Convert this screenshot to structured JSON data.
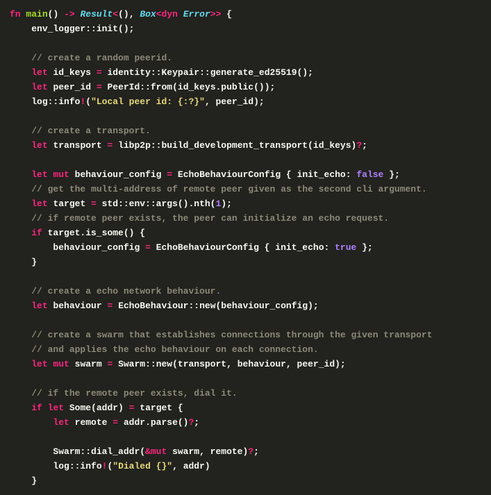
{
  "code": {
    "l1": {
      "kw1": "fn",
      "name": "main",
      "p1": "() ",
      "arrow": "->",
      "sp1": " ",
      "ty1": "Result",
      "lt": "<",
      "p2": "(), ",
      "ty2": "Box",
      "lt2": "<",
      "kw2": "dyn",
      "sp2": " ",
      "ty3": "Error",
      "gt": ">>",
      "sp3": " {"
    },
    "l2": {
      "indent": "    ",
      "t": "env_logger::init();"
    },
    "l4": {
      "indent": "    ",
      "c": "// create a random peerid."
    },
    "l5": {
      "indent": "    ",
      "kw": "let",
      "sp": " ",
      "id": "id_keys ",
      "eq": "=",
      "rest": " identity::Keypair::generate_ed25519();"
    },
    "l6": {
      "indent": "    ",
      "kw": "let",
      "sp": " ",
      "id": "peer_id ",
      "eq": "=",
      "rest": " PeerId::from(id_keys.public());"
    },
    "l7": {
      "indent": "    ",
      "pre": "log::info",
      "bang": "!",
      "p1": "(",
      "str": "\"Local peer id: {:?}\"",
      "rest": ", peer_id);"
    },
    "l9": {
      "indent": "    ",
      "c": "// create a transport."
    },
    "l10": {
      "indent": "    ",
      "kw": "let",
      "sp": " ",
      "id": "transport ",
      "eq": "=",
      "rest": " libp2p::build_development_transport(id_keys)",
      "q": "?",
      "semi": ";"
    },
    "l12": {
      "indent": "    ",
      "kw": "let",
      "sp": " ",
      "kw2": "mut",
      "sp2": " ",
      "id": "behaviour_config ",
      "eq": "=",
      "rest": " EchoBehaviourConfig { init_echo: ",
      "bool": "false",
      "end": " };"
    },
    "l13": {
      "indent": "    ",
      "c": "// get the multi-address of remote peer given as the second cli argument."
    },
    "l14": {
      "indent": "    ",
      "kw": "let",
      "sp": " ",
      "id": "target ",
      "eq": "=",
      "rest": " std::env::args().nth(",
      "num": "1",
      "end": ");"
    },
    "l15": {
      "indent": "    ",
      "c": "// if remote peer exists, the peer can initialize an echo request."
    },
    "l16": {
      "indent": "    ",
      "kw": "if",
      "rest": " target.is_some() {"
    },
    "l17": {
      "indent": "        ",
      "id": "behaviour_config ",
      "eq": "=",
      "rest": " EchoBehaviourConfig { init_echo: ",
      "bool": "true",
      "end": " };"
    },
    "l18": {
      "indent": "    ",
      "t": "}"
    },
    "l20": {
      "indent": "    ",
      "c": "// create a echo network behaviour."
    },
    "l21": {
      "indent": "    ",
      "kw": "let",
      "sp": " ",
      "id": "behaviour ",
      "eq": "=",
      "rest": " EchoBehaviour::new(behaviour_config);"
    },
    "l23": {
      "indent": "    ",
      "c": "// create a swarm that establishes connections through the given transport"
    },
    "l24": {
      "indent": "    ",
      "c": "// and applies the echo behaviour on each connection."
    },
    "l25": {
      "indent": "    ",
      "kw": "let",
      "sp": " ",
      "kw2": "mut",
      "sp2": " ",
      "id": "swarm ",
      "eq": "=",
      "rest": " Swarm::new(transport, behaviour, peer_id);"
    },
    "l27": {
      "indent": "    ",
      "c": "// if the remote peer exists, dial it."
    },
    "l28": {
      "indent": "    ",
      "kw": "if",
      "sp": " ",
      "kw2": "let",
      "sp2": " ",
      "some": "Some",
      "p": "(addr) ",
      "eq": "=",
      "rest": " target {"
    },
    "l29": {
      "indent": "        ",
      "kw": "let",
      "sp": " ",
      "id": "remote ",
      "eq": "=",
      "rest": " addr.parse()",
      "q": "?",
      "semi": ";"
    },
    "l31": {
      "indent": "        ",
      "pre": "Swarm::dial_addr(",
      "amp": "&",
      "kw": "mut",
      "rest": " swarm, remote)",
      "q": "?",
      "semi": ";"
    },
    "l32": {
      "indent": "        ",
      "pre": "log::info",
      "bang": "!",
      "p1": "(",
      "str": "\"Dialed {}\"",
      "rest": ", addr)"
    },
    "l33": {
      "indent": "    ",
      "t": "}"
    }
  }
}
